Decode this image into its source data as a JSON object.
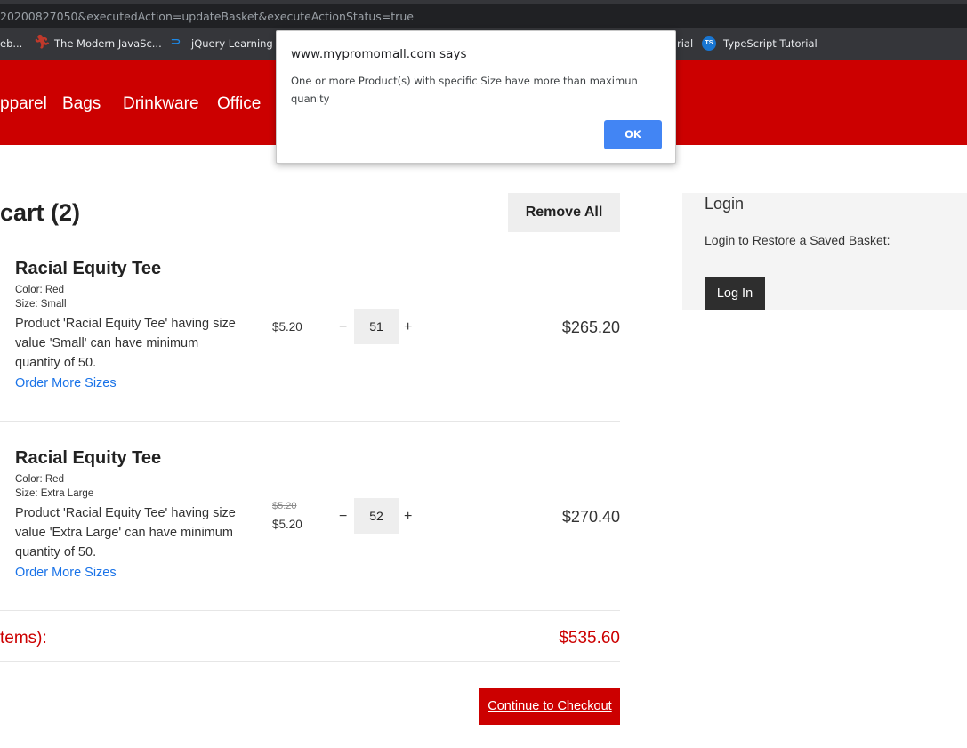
{
  "browser": {
    "url_fragment": "20200827050&executedAction=updateBasket&executeActionStatus=true",
    "bookmarks": [
      {
        "label": "eb...",
        "icon": "bookmark-icon"
      },
      {
        "label": "The Modern JavaSc...",
        "icon": "javascript-figure-icon",
        "color": "#c0392b"
      },
      {
        "label": "jQuery Learning C",
        "icon": "jquery-icon",
        "color": "#1e88e5"
      },
      {
        "label": "rial",
        "icon": "bookmark-icon"
      },
      {
        "label": "TypeScript Tutorial",
        "icon": "typescript-icon",
        "icon_text": "TS",
        "color": "#1976d2"
      }
    ]
  },
  "nav": {
    "items": [
      "pparel",
      "Bags",
      "Drinkware",
      "Office"
    ],
    "bg_color": "#cc0000"
  },
  "cart": {
    "title": "cart (2)",
    "remove_all_label": "Remove All",
    "items": [
      {
        "name": "Racial Equity Tee",
        "color_label": "Color: Red",
        "size_label": "Size: Small",
        "note": "Product 'Racial Equity Tee' having size value 'Small' can have minimum quantity of 50.",
        "link": "Order More Sizes",
        "price": "$5.20",
        "quantity": "51",
        "minus": "−",
        "plus": "+",
        "total": "$265.20"
      },
      {
        "name": "Racial Equity Tee",
        "color_label": "Color: Red",
        "size_label": "Size: Extra Large",
        "note": "Product 'Racial Equity Tee' having size value 'Extra Large' can have minimum quantity of 50.",
        "link": "Order More Sizes",
        "price_old": "$5.20",
        "price": "$5.20",
        "quantity": "52",
        "minus": "−",
        "plus": "+",
        "total": "$270.40"
      }
    ],
    "subtotal_label": "tems):",
    "subtotal_value": "$535.60",
    "checkout_label": "Continue to Checkout"
  },
  "login": {
    "title": "Login",
    "text": "Login to Restore a Saved Basket:",
    "button": "Log In"
  },
  "dialog": {
    "title": "www.mypromomall.com says",
    "message": "One or more Product(s) with specific Size have more than maximun quanity",
    "ok_label": "OK",
    "ok_color": "#4285f4"
  }
}
